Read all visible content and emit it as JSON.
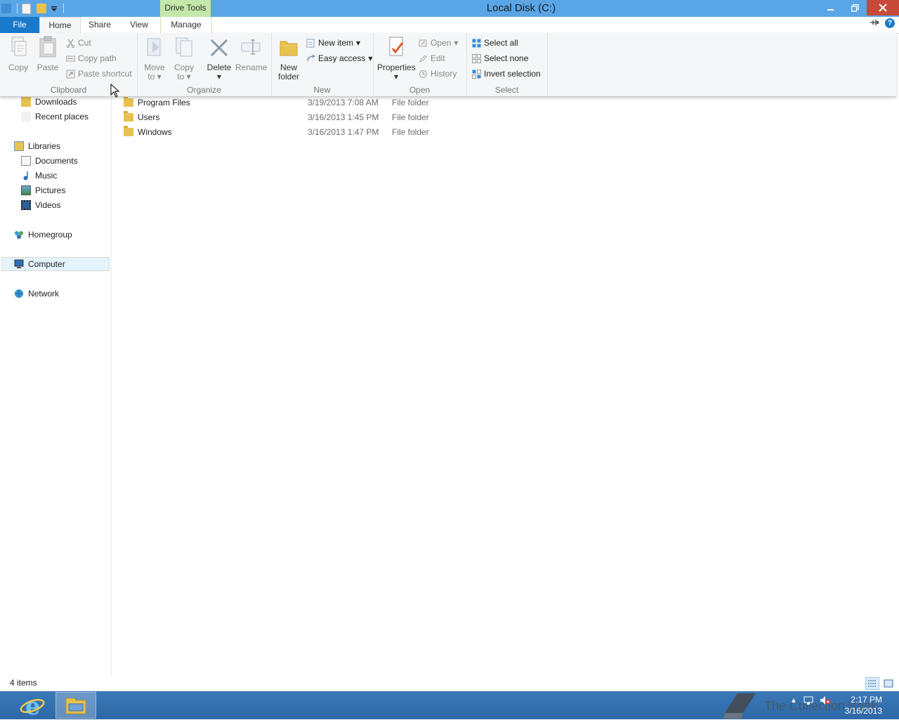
{
  "window": {
    "title": "Local Disk (C:)",
    "context_tab_group": "Drive Tools"
  },
  "tabs": {
    "file": "File",
    "home": "Home",
    "share": "Share",
    "view": "View",
    "manage": "Manage"
  },
  "ribbon": {
    "clipboard": {
      "label": "Clipboard",
      "copy": "Copy",
      "paste": "Paste",
      "cut": "Cut",
      "copy_path": "Copy path",
      "paste_shortcut": "Paste shortcut"
    },
    "organize": {
      "label": "Organize",
      "move_to_1": "Move",
      "move_to_2": "to",
      "copy_to_1": "Copy",
      "copy_to_2": "to",
      "delete": "Delete",
      "rename": "Rename"
    },
    "new": {
      "label": "New",
      "new_folder_1": "New",
      "new_folder_2": "folder",
      "new_item": "New item",
      "easy_access": "Easy access"
    },
    "open": {
      "label": "Open",
      "properties": "Properties",
      "open": "Open",
      "edit": "Edit",
      "history": "History"
    },
    "select": {
      "label": "Select",
      "select_all": "Select all",
      "select_none": "Select none",
      "invert_selection": "Invert selection"
    }
  },
  "nav": {
    "downloads": "Downloads",
    "recent_places": "Recent places",
    "libraries": "Libraries",
    "documents": "Documents",
    "music": "Music",
    "pictures": "Pictures",
    "videos": "Videos",
    "homegroup": "Homegroup",
    "computer": "Computer",
    "network": "Network"
  },
  "files": [
    {
      "name": "Program Files",
      "date": "3/19/2013 7:08 AM",
      "type": "File folder"
    },
    {
      "name": "Users",
      "date": "3/16/2013 1:45 PM",
      "type": "File folder"
    },
    {
      "name": "Windows",
      "date": "3/16/2013 1:47 PM",
      "type": "File folder"
    }
  ],
  "status": {
    "item_count": "4 items"
  },
  "taskbar": {
    "watermark": "The Collection Book",
    "time": "2:17 PM",
    "date": "3/16/2013"
  },
  "colors": {
    "titlebar": "#5aa5e6",
    "file_tab": "#1979ca",
    "drive_tools": "#c4e8a9",
    "close_button": "#c7493a",
    "taskbar": "#3b79b8"
  }
}
